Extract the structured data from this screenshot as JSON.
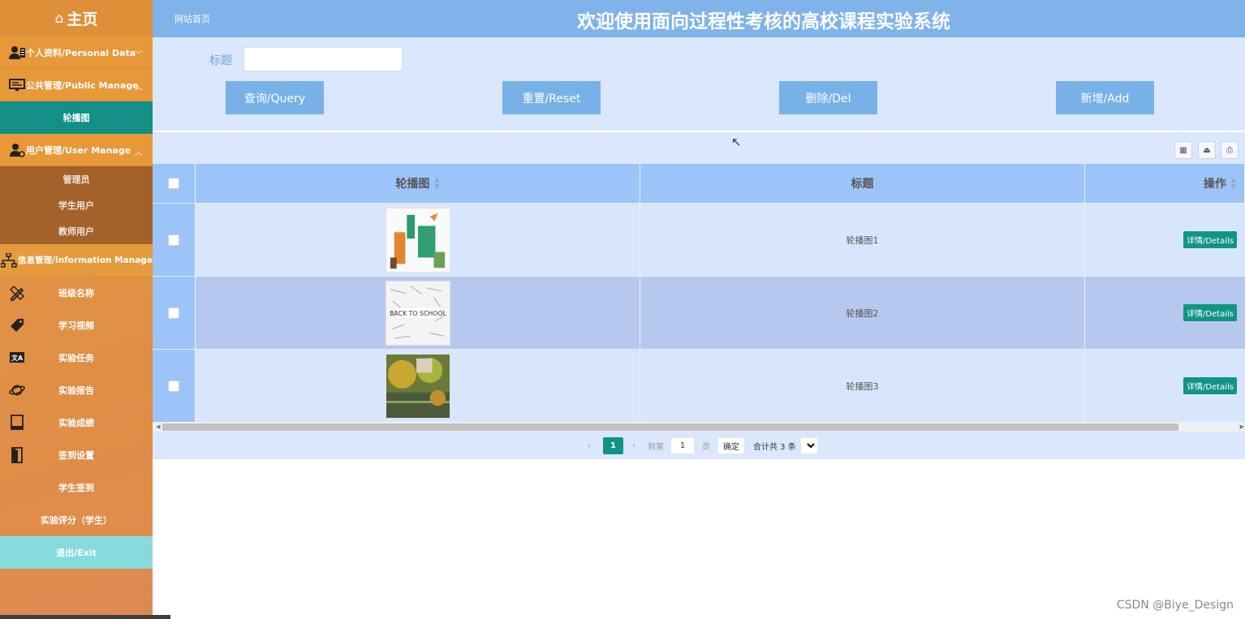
{
  "sidebar": {
    "home": "主页",
    "groups": {
      "personal": "个人资料/Personal Data",
      "public": "公共管理/Public Manage",
      "user": "用户管理/User Manage",
      "info": "信息管理/Information Manage"
    },
    "public_items": [
      "轮播图"
    ],
    "user_items": [
      "管理员",
      "学生用户",
      "教师用户"
    ],
    "info_items": [
      "班级名称",
      "学习视频",
      "实验任务",
      "实验报告",
      "实验成绩",
      "签到设置",
      "学生签到",
      "实验评分（学生）"
    ],
    "exit": "退出/Exit"
  },
  "header": {
    "breadcrumb": "网站首页",
    "title": "欢迎使用面向过程性考核的高校课程实验系统"
  },
  "search": {
    "label": "标题",
    "value": "",
    "buttons": {
      "query": "查询/Query",
      "reset": "重置/Reset",
      "delete": "删除/Del",
      "add": "新增/Add"
    }
  },
  "table": {
    "columns": [
      "轮播图",
      "标题",
      "操作"
    ],
    "rows": [
      {
        "title": "轮播图1",
        "action": "详情/Details"
      },
      {
        "title": "轮播图2",
        "action": "详情/Details"
      },
      {
        "title": "轮播图3",
        "action": "详情/Details"
      }
    ]
  },
  "pagination": {
    "current": "1",
    "goto_label": "到第",
    "page_input": "1",
    "page_suffix": "页",
    "confirm": "确定",
    "total": "合计共 3 条"
  },
  "watermark": "CSDN @Biye_Design",
  "colors": {
    "sidebar": "#e39443",
    "active_item": "#138f87",
    "header": "#7fb3ea",
    "button": "#78b1e8",
    "table_header": "#9dc4f8",
    "detail_button": "#119486"
  }
}
